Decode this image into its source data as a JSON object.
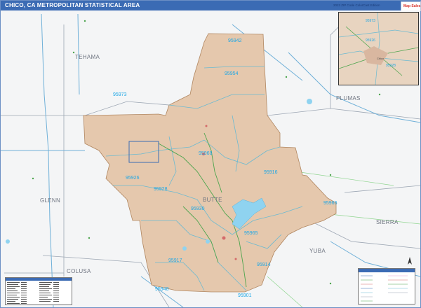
{
  "title": "CHICO, CA METROPOLITAN STATISTICAL AREA",
  "edition": "2023 ZIP Code ColorCast Edition",
  "logo": "Map Sales",
  "counties": [
    "TEHAMA",
    "PLUMAS",
    "BUTTE",
    "GLENN",
    "SIERRA",
    "YUBA",
    "COLUSA"
  ],
  "zip_codes": [
    "95942",
    "95954",
    "95973",
    "95968",
    "95926",
    "95928",
    "95916",
    "95965",
    "95966",
    "95930",
    "95917",
    "95914",
    "95948",
    "95901"
  ],
  "inset_zips": [
    "95973",
    "95926",
    "95928"
  ],
  "inset_city": "Chico",
  "colors": {
    "title_bar": "#3b6bb4",
    "land": "#e5c8ad",
    "surrounding": "#f4f5f6",
    "zip_label": "#1ea7e6",
    "boundary": "#6bbad1",
    "water": "#8fd3f0"
  },
  "icons": [
    "north-arrow-icon"
  ]
}
